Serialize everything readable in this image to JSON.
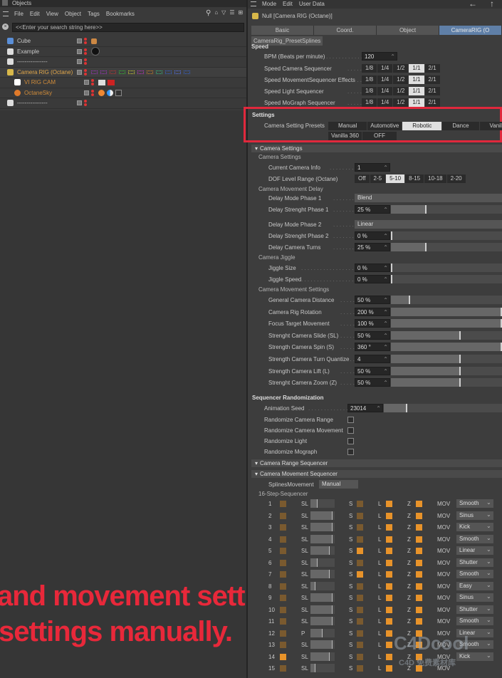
{
  "left_panel": {
    "title": "Objects",
    "menu": [
      "File",
      "Edit",
      "View",
      "Object",
      "Tags",
      "Bookmarks"
    ],
    "search_placeholder": "<<Enter your search string here>>",
    "objects": [
      {
        "name": "Cube",
        "color": "#c8c8c8"
      },
      {
        "name": "Example",
        "color": "#c8c8c8"
      },
      {
        "name": "----------------",
        "color": "#c8c8c8"
      },
      {
        "name": "Camera RIG (Octane)",
        "color": "#e0a64a"
      },
      {
        "name": "VI RIG CAM",
        "color": "#d08c3a"
      },
      {
        "name": "OctaneSky",
        "color": "#d08c3a"
      },
      {
        "name": "----------------",
        "color": "#c8c8c8"
      }
    ]
  },
  "right_panel": {
    "menu": [
      "Mode",
      "Edit",
      "User Data"
    ],
    "object_title": "Null [Camera RIG (Octane)]",
    "tabs": [
      "Basic",
      "Coord.",
      "Object",
      "CameraRIG (O"
    ],
    "subtab": "CameraRig_PresetSplines",
    "speed_title": "Speed",
    "bpm_label": "BPM (Beats per minute)",
    "bpm_value": "120",
    "speed_rows": [
      {
        "label": "Speed Camera Sequencer"
      },
      {
        "label": "Speed MovementSequencer Effects"
      },
      {
        "label": "Speed Light Sequencer"
      },
      {
        "label": "Speed MoGraph Sequencer"
      }
    ],
    "speed_options": [
      "1/8",
      "1/4",
      "1/2",
      "1/1",
      "2/1"
    ],
    "speed_selected": "1/1",
    "settings_title": "Settings",
    "preset_label": "Camera Setting Presets",
    "presets_row1": [
      "Manual",
      "Automotive",
      "Robotic",
      "Dance",
      "Vanilla"
    ],
    "presets_row2": [
      "Vanilla 360",
      "OFF"
    ],
    "preset_selected": "Robotic",
    "camera_settings_section": "Camera Settings",
    "camera_settings_group": "Camera Settings",
    "current_camera_label": "Current Camera Info",
    "current_camera_value": "1",
    "dof_label": "DOF Level Range (Octane)",
    "dof_options": [
      "Off",
      "2-5",
      "5-10",
      "8-15",
      "10-18",
      "2-20"
    ],
    "dof_selected": "5-10",
    "movement_delay_group": "Camera Movement Delay",
    "delay_rows": [
      {
        "label": "Delay Mode Phase 1",
        "value": "Blend",
        "type": "dropdown"
      },
      {
        "label": "Delay Strenght Phase 1",
        "value": "25 %",
        "type": "slider",
        "level": 0.32
      },
      {
        "label": "Delay Mode Phase 2",
        "value": "Linear",
        "type": "dropdown"
      },
      {
        "label": "Delay Strenght Phase 2",
        "value": "0 %",
        "type": "slider",
        "level": 0.0
      },
      {
        "label": "Delay Camera Turns",
        "value": "25 %",
        "type": "slider",
        "level": 0.32
      }
    ],
    "jiggle_group": "Camera Jiggle",
    "jiggle_rows": [
      {
        "label": "Jiggle Size",
        "value": "0 %",
        "level": 0.0
      },
      {
        "label": "Jiggle Speed",
        "value": "0 %",
        "level": 0.0
      }
    ],
    "movement_settings_group": "Camera Movement Settings",
    "movement_rows": [
      {
        "label": "General Camera Distance",
        "value": "50 %",
        "level": 0.17,
        "orange": false
      },
      {
        "label": "Camera Rig Rotation",
        "value": "200 %",
        "level": 1.0,
        "orange": false
      },
      {
        "label": "Focus Target Movement",
        "value": "100 %",
        "level": 1.0,
        "orange": false
      },
      {
        "label": "Strenght Camera Slide (SL)",
        "value": "50 %",
        "level": 0.63,
        "orange": false
      },
      {
        "label": "Strength Camera Spin (S)",
        "value": "360 °",
        "level": 1.0,
        "orange": false
      },
      {
        "label": "Strength Camera Turn Quantize",
        "value": "4",
        "level": 0.63,
        "orange": false
      },
      {
        "label": "Strength Camera Lift (L)",
        "value": "50 %",
        "level": 0.63,
        "orange": true
      },
      {
        "label": "Strenght Camera Zoom (Z)",
        "value": "50 %",
        "level": 0.63,
        "orange": false
      }
    ],
    "randomization_title": "Sequencer Randomization",
    "seed_label": "Animation Seed",
    "seed_value": "23014",
    "seed_level": 0.2,
    "random_checks": [
      {
        "label": "Randomize Camera Range"
      },
      {
        "label": "Randomize Camera Movement"
      },
      {
        "label": "Randomize Light"
      },
      {
        "label": "Randomize Mograph"
      }
    ],
    "range_sequencer_section": "Camera Range Sequencer",
    "movement_sequencer_section": "Camera Movement Sequencer",
    "splines_label": "SplinesMovement",
    "splines_value": "Manual",
    "step_sequencer_group": "16-Step-Sequencer",
    "steps": [
      {
        "n": "1",
        "t": "SL",
        "l": "S",
        "m": "L",
        "z": "Z",
        "mov": "MOV",
        "ease": "Smooth"
      },
      {
        "n": "2",
        "t": "SL",
        "l": "S",
        "m": "L",
        "z": "Z",
        "mov": "MOV",
        "ease": "Sinus"
      },
      {
        "n": "3",
        "t": "SL",
        "l": "S",
        "m": "L",
        "z": "Z",
        "mov": "MOV",
        "ease": "Kick"
      },
      {
        "n": "4",
        "t": "SL",
        "l": "S",
        "m": "L",
        "z": "Z",
        "mov": "MOV",
        "ease": "Smooth"
      },
      {
        "n": "5",
        "t": "SL",
        "l": "S",
        "m": "L",
        "z": "Z",
        "mov": "MOV",
        "ease": "Linear"
      },
      {
        "n": "6",
        "t": "SL",
        "l": "S",
        "m": "L",
        "z": "Z",
        "mov": "MOV",
        "ease": "Shutter"
      },
      {
        "n": "7",
        "t": "SL",
        "l": "S",
        "m": "L",
        "z": "Z",
        "mov": "MOV",
        "ease": "Smooth"
      },
      {
        "n": "8",
        "t": "SL",
        "l": "S",
        "m": "L",
        "z": "Z",
        "mov": "MOV",
        "ease": "Easy"
      },
      {
        "n": "9",
        "t": "SL",
        "l": "S",
        "m": "L",
        "z": "Z",
        "mov": "MOV",
        "ease": "Sinus"
      },
      {
        "n": "10",
        "t": "SL",
        "l": "S",
        "m": "L",
        "z": "Z",
        "mov": "MOV",
        "ease": "Shutter"
      },
      {
        "n": "11",
        "t": "SL",
        "l": "S",
        "m": "L",
        "z": "Z",
        "mov": "MOV",
        "ease": "Smooth"
      },
      {
        "n": "12",
        "t": "P",
        "l": "S",
        "m": "L",
        "z": "Z",
        "mov": "MOV",
        "ease": "Linear"
      },
      {
        "n": "13",
        "t": "SL",
        "l": "S",
        "m": "L",
        "z": "Z",
        "mov": "MOV",
        "ease": "Smooth"
      },
      {
        "n": "14",
        "t": "SL",
        "l": "S",
        "m": "L",
        "z": "Z",
        "mov": "MOV",
        "ease": "Kick"
      },
      {
        "n": "15",
        "t": "SL",
        "l": "S",
        "m": "L",
        "z": "Z",
        "mov": "MOV",
        "ease": ""
      }
    ]
  },
  "overlay": {
    "line1": "and movement settings.",
    "line2": "settings manually."
  },
  "watermark": {
    "big": "C4Dcool",
    "small": "C4D 免费素材库"
  }
}
